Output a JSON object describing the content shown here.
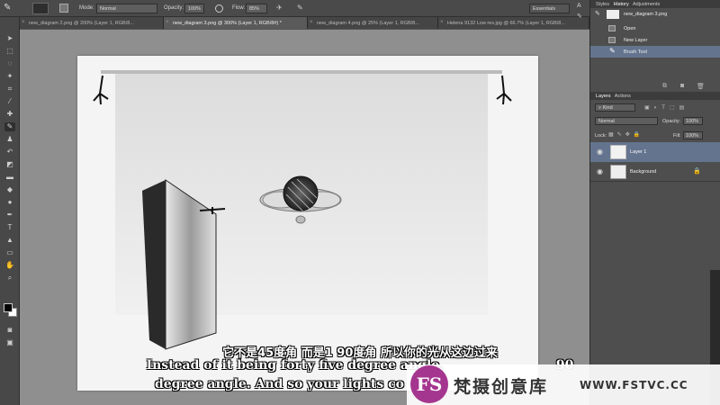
{
  "options_bar": {
    "mode_label": "Mode:",
    "mode_value": "Normal",
    "opacity_label": "Opacity:",
    "opacity_value": "100%",
    "flow_label": "Flow:",
    "flow_value": "85%",
    "workspace": "Essentials"
  },
  "tabs": [
    {
      "label": "new_diagram 2.png @ 200% (Layer 1, RGB/8...",
      "active": false
    },
    {
      "label": "new_diagram 3.png @ 300% (Layer 1, RGB/8#) *",
      "active": true
    },
    {
      "label": "new_diagram 4.png @ 25% (Layer 1, RGB/8...",
      "active": false
    },
    {
      "label": "Helena 9132 Low res.jpg @ 66.7% (Layer 1, RGB/8...",
      "active": false
    }
  ],
  "history_panel": {
    "tabs": [
      "Styles",
      "History",
      "Adjustments"
    ],
    "snapshot": "new_diagram 3.png",
    "items": [
      "Open",
      "New Layer",
      "Brush Tool"
    ]
  },
  "layers_panel": {
    "tabs": [
      "Layers",
      "Actions"
    ],
    "kind": "Kind",
    "blend_mode": "Normal",
    "opacity_label": "Opacity:",
    "opacity_value": "100%",
    "lock_label": "Lock:",
    "fill_label": "Fill:",
    "fill_value": "100%",
    "layers": [
      {
        "name": "Layer 1",
        "selected": true
      },
      {
        "name": "Background",
        "selected": false
      }
    ]
  },
  "subtitles": {
    "chinese": "它不是45度角 而是1 90度角 所以你的光从这边过来",
    "english_line1": "Instead of it being forty five degree angle,",
    "english_line1_tail": "90",
    "english_line2": "degree angle. And so your lights co"
  },
  "watermark": {
    "logo": "FS",
    "brand_cn": "梵摄创意库",
    "url": "WWW.FSTVC.CC"
  },
  "colors": {
    "accent": "#a4368f",
    "selected_row": "#64748f"
  }
}
